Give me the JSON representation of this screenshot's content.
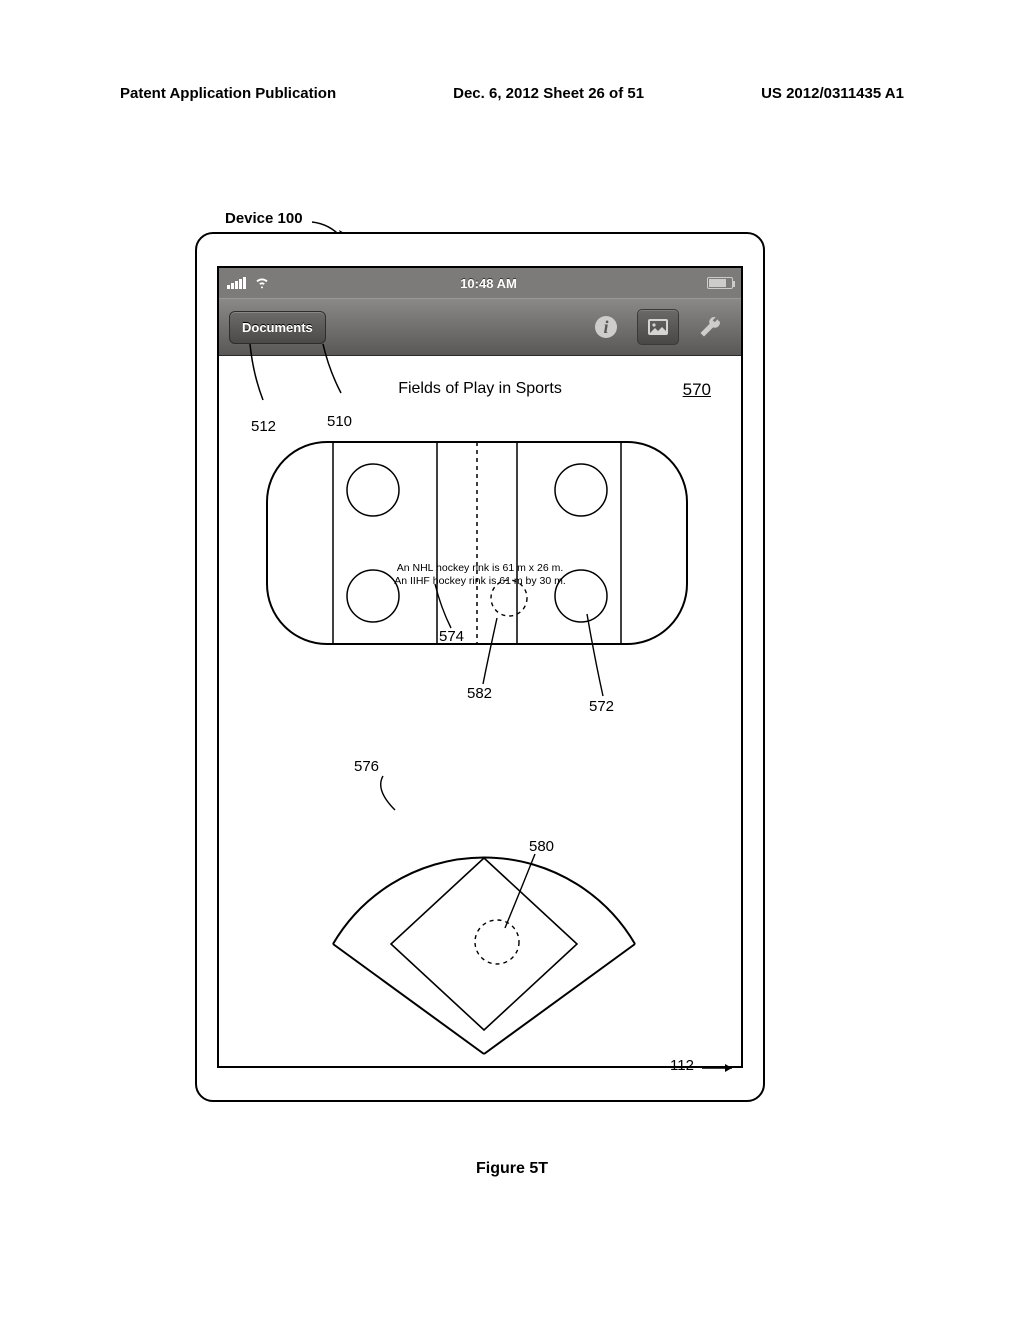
{
  "header": {
    "left": "Patent Application Publication",
    "center": "Dec. 6, 2012   Sheet 26 of 51",
    "right": "US 2012/0311435 A1"
  },
  "device_label": "Device 100",
  "status": {
    "time": "10:48 AM"
  },
  "toolbar": {
    "documents_label": "Documents"
  },
  "doc": {
    "title": "Fields of Play in Sports",
    "rink_line1": "An NHL hockey rink is 61 m x 26 m.",
    "rink_line2": "An IIHF hockey rink is 61 m by 30 m."
  },
  "refs": {
    "r570": "570",
    "r512": "512",
    "r510": "510",
    "r574": "574",
    "r582": "582",
    "r572": "572",
    "r576": "576",
    "r580": "580",
    "r112": "112"
  },
  "figure_label": "Figure 5T"
}
